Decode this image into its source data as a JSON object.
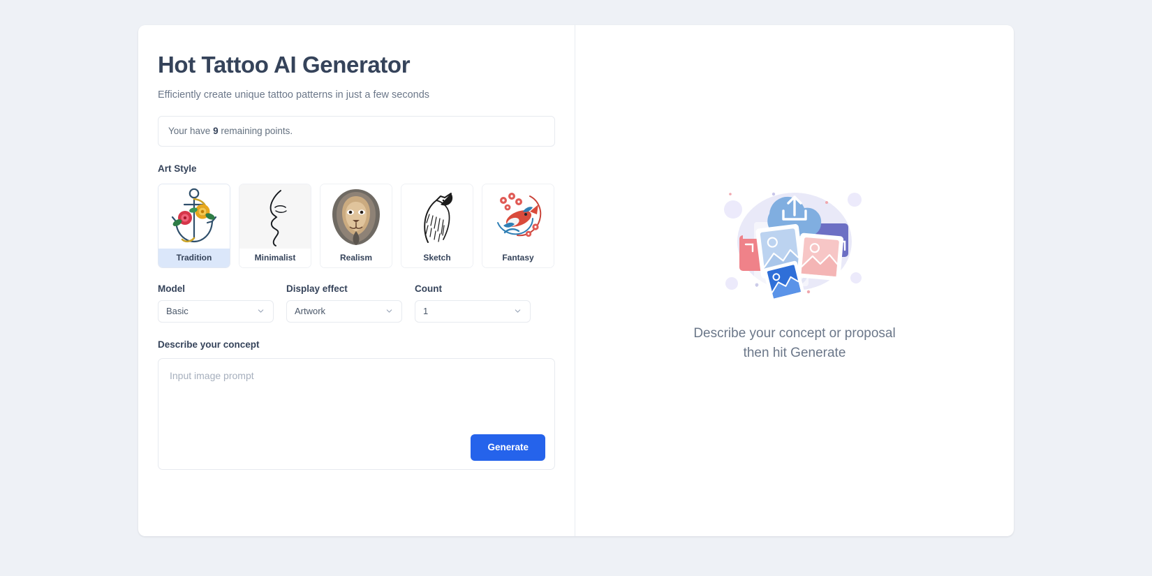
{
  "app": {
    "title": "Hot Tattoo AI Generator",
    "subtitle": "Efficiently create unique tattoo patterns in just a few seconds"
  },
  "points": {
    "prefix": "Your have",
    "value": "9",
    "suffix": "remaining points."
  },
  "art_style": {
    "label": "Art Style",
    "selected": "Tradition",
    "options": [
      {
        "label": "Tradition",
        "icon": "anchor-roses-tattoo-icon",
        "selected": true,
        "tinted": false
      },
      {
        "label": "Minimalist",
        "icon": "face-line-art-icon",
        "selected": false,
        "tinted": true
      },
      {
        "label": "Realism",
        "icon": "lion-head-icon",
        "selected": false,
        "tinted": false
      },
      {
        "label": "Sketch",
        "icon": "howling-wolf-icon",
        "selected": false,
        "tinted": false
      },
      {
        "label": "Fantasy",
        "icon": "koi-fish-blossom-icon",
        "selected": false,
        "tinted": false
      }
    ]
  },
  "model": {
    "label": "Model",
    "value": "Basic",
    "icon": "chevron-down-icon"
  },
  "display_effect": {
    "label": "Display effect",
    "value": "Artwork",
    "icon": "chevron-down-icon"
  },
  "count": {
    "label": "Count",
    "value": "1",
    "icon": "chevron-down-icon"
  },
  "prompt": {
    "label": "Describe your concept",
    "placeholder": "Input image prompt",
    "value": ""
  },
  "generate_button": {
    "label": "Generate"
  },
  "preview": {
    "illustration_icon": "cloud-upload-images-illustration",
    "line1": "Describe your concept or proposal",
    "line2": "then hit Generate"
  },
  "colors": {
    "page_background": "#eef1f6",
    "card_background": "#ffffff",
    "heading": "#35435a",
    "muted_text": "#6b7789",
    "accent_blue": "#2563eb",
    "selected_chip": "#dbe7fa",
    "border": "#e7eaef"
  }
}
